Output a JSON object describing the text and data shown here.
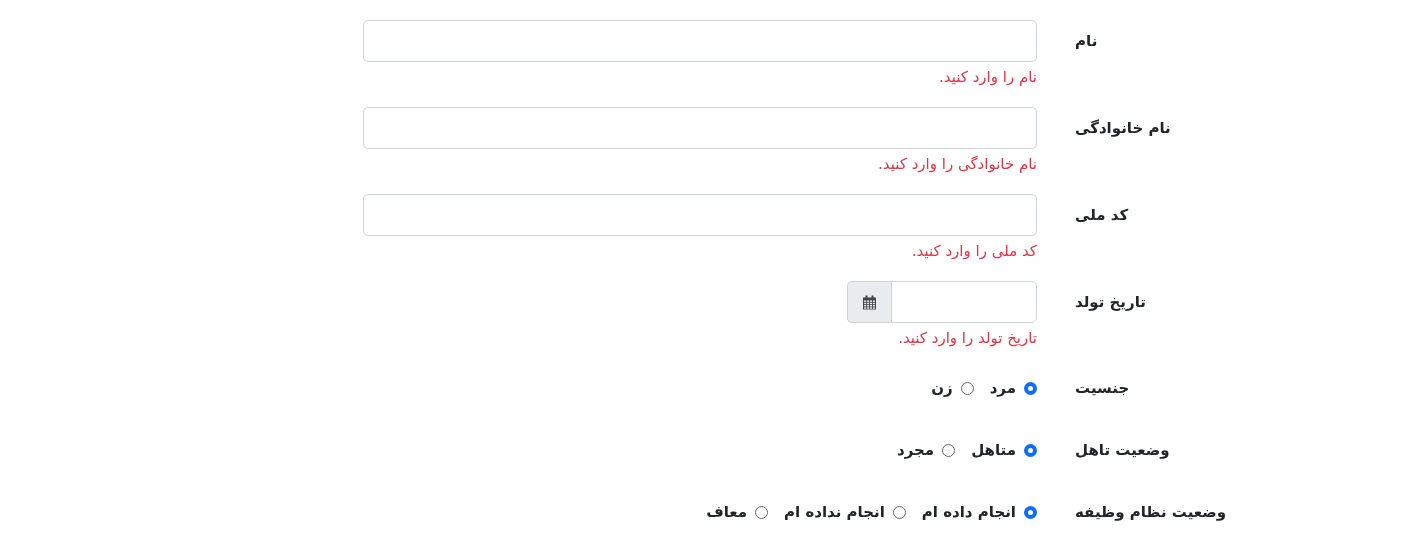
{
  "fields": [
    {
      "kind": "text",
      "label": "نام",
      "error": "نام را وارد کنید."
    },
    {
      "kind": "text",
      "label": "نام خانوادگی",
      "error": "نام خانوادگی را وارد کنید."
    },
    {
      "kind": "text",
      "label": "کد ملی",
      "error": "کد ملی را وارد کنید."
    },
    {
      "kind": "date",
      "label": "تاریخ تولد",
      "error": "تاریخ تولد را وارد کنید."
    },
    {
      "kind": "radio",
      "label": "جنسیت",
      "options": [
        {
          "label": "مرد",
          "selected": true
        },
        {
          "label": "زن",
          "selected": false
        }
      ]
    },
    {
      "kind": "radio",
      "label": "وضعیت تاهل",
      "options": [
        {
          "label": "متاهل",
          "selected": true
        },
        {
          "label": "مجرد",
          "selected": false
        }
      ]
    },
    {
      "kind": "radio",
      "label": "وضعیت نظام وظیفه",
      "options": [
        {
          "label": "انجام داده ام",
          "selected": true
        },
        {
          "label": "انجام نداده ام",
          "selected": false
        },
        {
          "label": "معاف",
          "selected": false
        }
      ]
    }
  ]
}
